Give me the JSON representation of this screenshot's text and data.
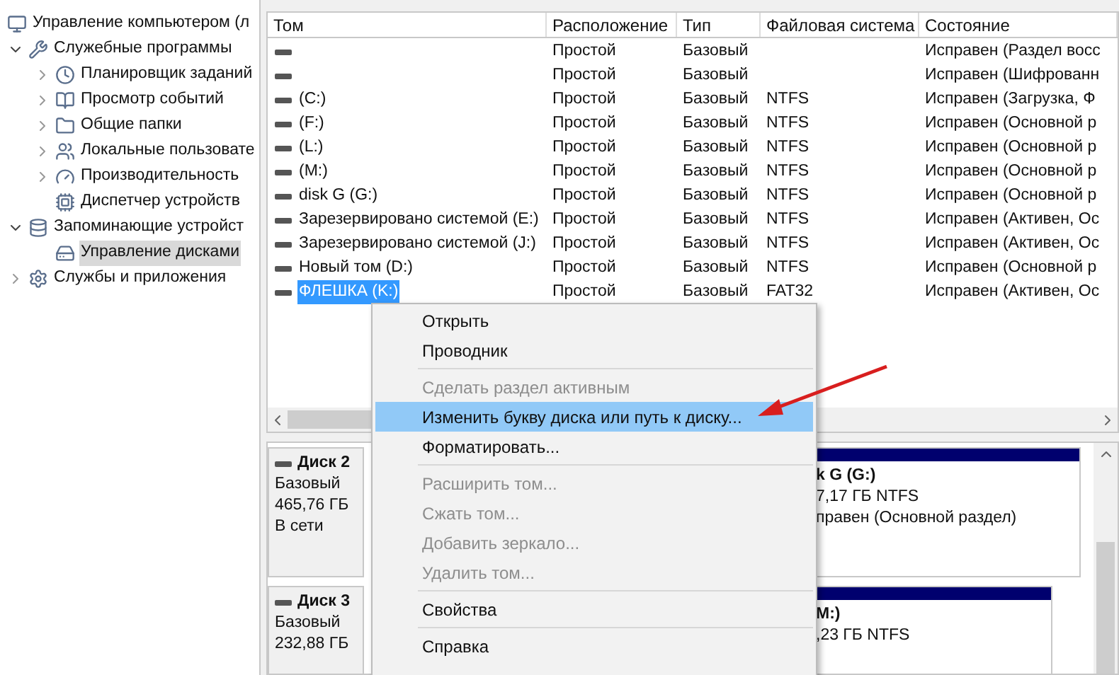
{
  "tree": [
    {
      "label": "Управление компьютером (л",
      "selected": false,
      "children": [
        {
          "label": "Служебные программы",
          "expanded": true,
          "selected": false,
          "children": [
            {
              "label": "Планировщик заданий",
              "expanded": false,
              "selected": false
            },
            {
              "label": "Просмотр событий",
              "expanded": false,
              "selected": false
            },
            {
              "label": "Общие папки",
              "expanded": false,
              "selected": false
            },
            {
              "label": "Локальные пользовате",
              "expanded": false,
              "selected": false
            },
            {
              "label": "Производительность",
              "expanded": false,
              "selected": false
            },
            {
              "label": "Диспетчер устройств",
              "selected": false
            }
          ]
        },
        {
          "label": "Запоминающие устройст",
          "expanded": true,
          "selected": false,
          "children": [
            {
              "label": "Управление дисками",
              "selected": true
            }
          ]
        },
        {
          "label": "Службы и приложения",
          "expanded": false,
          "selected": false
        }
      ]
    }
  ],
  "table": {
    "columns": [
      "Том",
      "Расположение",
      "Тип",
      "Файловая система",
      "Состояние"
    ],
    "rows": [
      {
        "volume": "",
        "layout": "Простой",
        "type": "Базовый",
        "fs": "",
        "status": "Исправен (Раздел восс",
        "selected": false
      },
      {
        "volume": "",
        "layout": "Простой",
        "type": "Базовый",
        "fs": "",
        "status": "Исправен (Шифрованн",
        "selected": false
      },
      {
        "volume": "(C:)",
        "layout": "Простой",
        "type": "Базовый",
        "fs": "NTFS",
        "status": "Исправен (Загрузка, Ф",
        "selected": false
      },
      {
        "volume": "(F:)",
        "layout": "Простой",
        "type": "Базовый",
        "fs": "NTFS",
        "status": "Исправен (Основной р",
        "selected": false
      },
      {
        "volume": "(L:)",
        "layout": "Простой",
        "type": "Базовый",
        "fs": "NTFS",
        "status": "Исправен (Основной р",
        "selected": false
      },
      {
        "volume": "(M:)",
        "layout": "Простой",
        "type": "Базовый",
        "fs": "NTFS",
        "status": "Исправен (Основной р",
        "selected": false
      },
      {
        "volume": "disk G (G:)",
        "layout": "Простой",
        "type": "Базовый",
        "fs": "NTFS",
        "status": "Исправен (Основной р",
        "selected": false
      },
      {
        "volume": "Зарезервировано системой (E:)",
        "layout": "Простой",
        "type": "Базовый",
        "fs": "NTFS",
        "status": "Исправен (Активен, Ос",
        "selected": false
      },
      {
        "volume": "Зарезервировано системой (J:)",
        "layout": "Простой",
        "type": "Базовый",
        "fs": "NTFS",
        "status": "Исправен (Активен, Ос",
        "selected": false
      },
      {
        "volume": "Новый том (D:)",
        "layout": "Простой",
        "type": "Базовый",
        "fs": "NTFS",
        "status": "Исправен (Основной р",
        "selected": false
      },
      {
        "volume": "ФЛЕШКА (K:)",
        "layout": "Простой",
        "type": "Базовый",
        "fs": "FAT32",
        "status": "Исправен (Активен, Ос",
        "selected": true
      }
    ]
  },
  "disks": [
    {
      "name": "Диск 2",
      "lines": [
        "Базовый",
        "465,76 ГБ",
        "В сети"
      ],
      "partition": {
        "title": "k G  (G:)",
        "lines": [
          "7,17 ГБ NTFS",
          "правен (Основной раздел)"
        ]
      }
    },
    {
      "name": "Диск 3",
      "lines": [
        "Базовый",
        "232,88 ГБ"
      ],
      "partition": {
        "title": "M:)",
        "lines": [
          ",23 ГБ NTFS"
        ]
      }
    }
  ],
  "context_menu": [
    {
      "label": "Открыть",
      "disabled": false,
      "selected": false
    },
    {
      "label": "Проводник",
      "disabled": false,
      "selected": false
    },
    {
      "kind": "separator"
    },
    {
      "label": "Сделать раздел активным",
      "disabled": true,
      "selected": false
    },
    {
      "label": "Изменить букву диска или путь к диску...",
      "disabled": false,
      "selected": true
    },
    {
      "label": "Форматировать...",
      "disabled": false,
      "selected": false
    },
    {
      "kind": "separator"
    },
    {
      "label": "Расширить том...",
      "disabled": true,
      "selected": false
    },
    {
      "label": "Сжать том...",
      "disabled": true,
      "selected": false
    },
    {
      "label": "Добавить зеркало...",
      "disabled": true,
      "selected": false
    },
    {
      "label": "Удалить том...",
      "disabled": true,
      "selected": false
    },
    {
      "kind": "separator"
    },
    {
      "label": "Свойства",
      "disabled": false,
      "selected": false
    },
    {
      "kind": "separator"
    },
    {
      "label": "Справка",
      "disabled": false,
      "selected": false
    }
  ]
}
